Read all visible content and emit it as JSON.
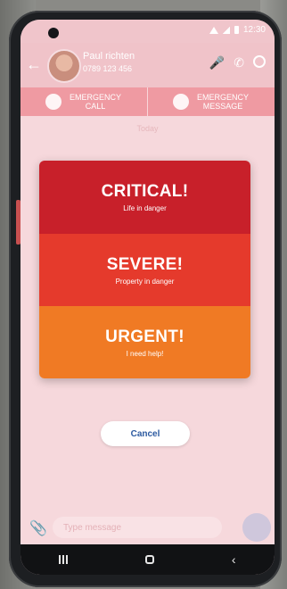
{
  "status_bar": {
    "time": "12:30"
  },
  "contact": {
    "name": "Paul richten",
    "phone": "0789 123 456"
  },
  "emergency_bar": {
    "call_label": "EMERGENCY CALL",
    "message_label": "EMERGENCY MESSAGE"
  },
  "chat": {
    "date_label": "Today"
  },
  "severity_dialog": {
    "levels": [
      {
        "title": "CRITICAL!",
        "subtitle": "Life in danger",
        "color": "#c8202a"
      },
      {
        "title": "SEVERE!",
        "subtitle": "Property in danger",
        "color": "#e53a2c"
      },
      {
        "title": "URGENT!",
        "subtitle": "I need help!",
        "color": "#f07a24"
      }
    ],
    "cancel_label": "Cancel"
  },
  "composer": {
    "placeholder": "Type message"
  },
  "colors": {
    "accent_blue": "#2c5aa0",
    "overlay_pink": "#f6d8dc"
  }
}
